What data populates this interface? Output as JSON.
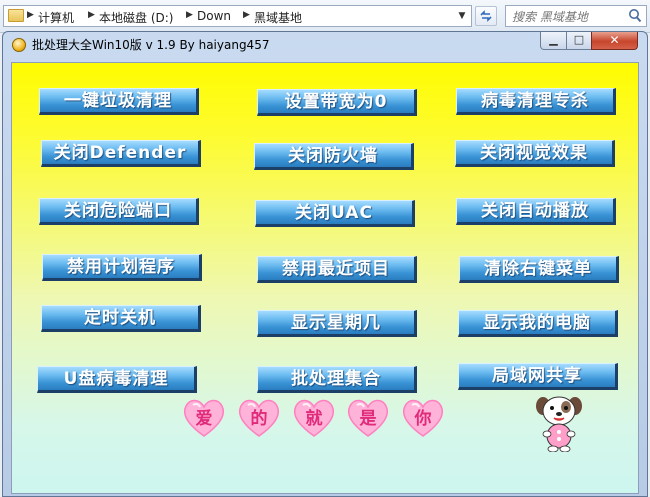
{
  "explorer": {
    "breadcrumbs": [
      "计算机",
      "本地磁盘 (D:)",
      "Down",
      "黑域基地"
    ],
    "search_placeholder": "搜索 黑域基地"
  },
  "window": {
    "title": "批处理大全Win10版 v 1.9  By haiyang457"
  },
  "buttons": [
    [
      "一键垃圾清理",
      "设置带宽为0",
      "病毒清理专杀"
    ],
    [
      "关闭Defender",
      "关闭防火墙",
      "关闭视觉效果"
    ],
    [
      "关闭危险端口",
      "关闭UAC",
      "关闭自动播放"
    ],
    [
      "禁用计划程序",
      "禁用最近项目",
      "清除右键菜单"
    ],
    [
      "定时关机",
      "显示星期几",
      "显示我的电脑"
    ],
    [
      "U盘病毒清理",
      "批处理集合",
      "局域网共享"
    ]
  ],
  "hearts": [
    "爱",
    "的",
    "就",
    "是",
    "你"
  ],
  "colors": {
    "button_fill": "#3892d4",
    "button_shadow": "#1b3f66",
    "heart_pink": "#ff9fcf",
    "heart_text": "#e02a7a"
  },
  "icons": {
    "app": "app-icon",
    "refresh": "refresh-icon",
    "search": "search-icon",
    "mascot": "puppy-mascot"
  }
}
